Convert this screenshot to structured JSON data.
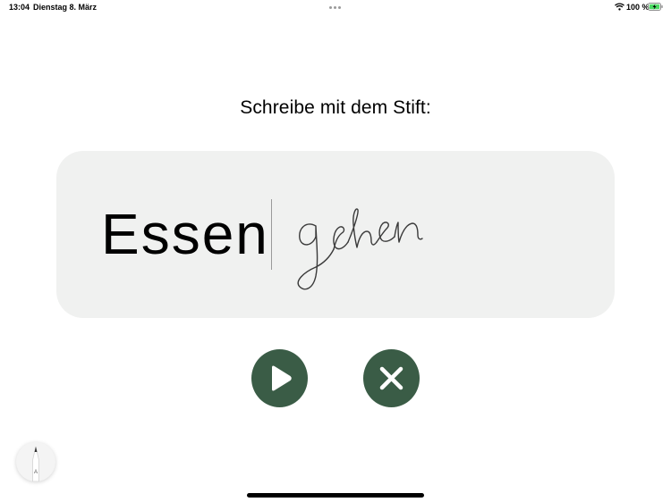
{
  "status_bar": {
    "time": "13:04",
    "date": "Dienstag 8. März",
    "battery_percent": "100 %",
    "icons": [
      "multitask-dots-icon",
      "wifi-icon",
      "battery-charging-icon"
    ]
  },
  "prompt": {
    "text": "Schreibe mit dem Stift:"
  },
  "write_panel": {
    "target_word": "Essen",
    "handwritten_input": "gehen"
  },
  "actions": {
    "play_icon": "play-icon",
    "close_icon": "close-icon"
  },
  "pencil_tool": {
    "icon": "pencil-icon",
    "label": "A"
  },
  "colors": {
    "button_bg": "#3a5c46",
    "panel_bg": "#f0f1f0",
    "battery_fill": "#4cd964"
  }
}
